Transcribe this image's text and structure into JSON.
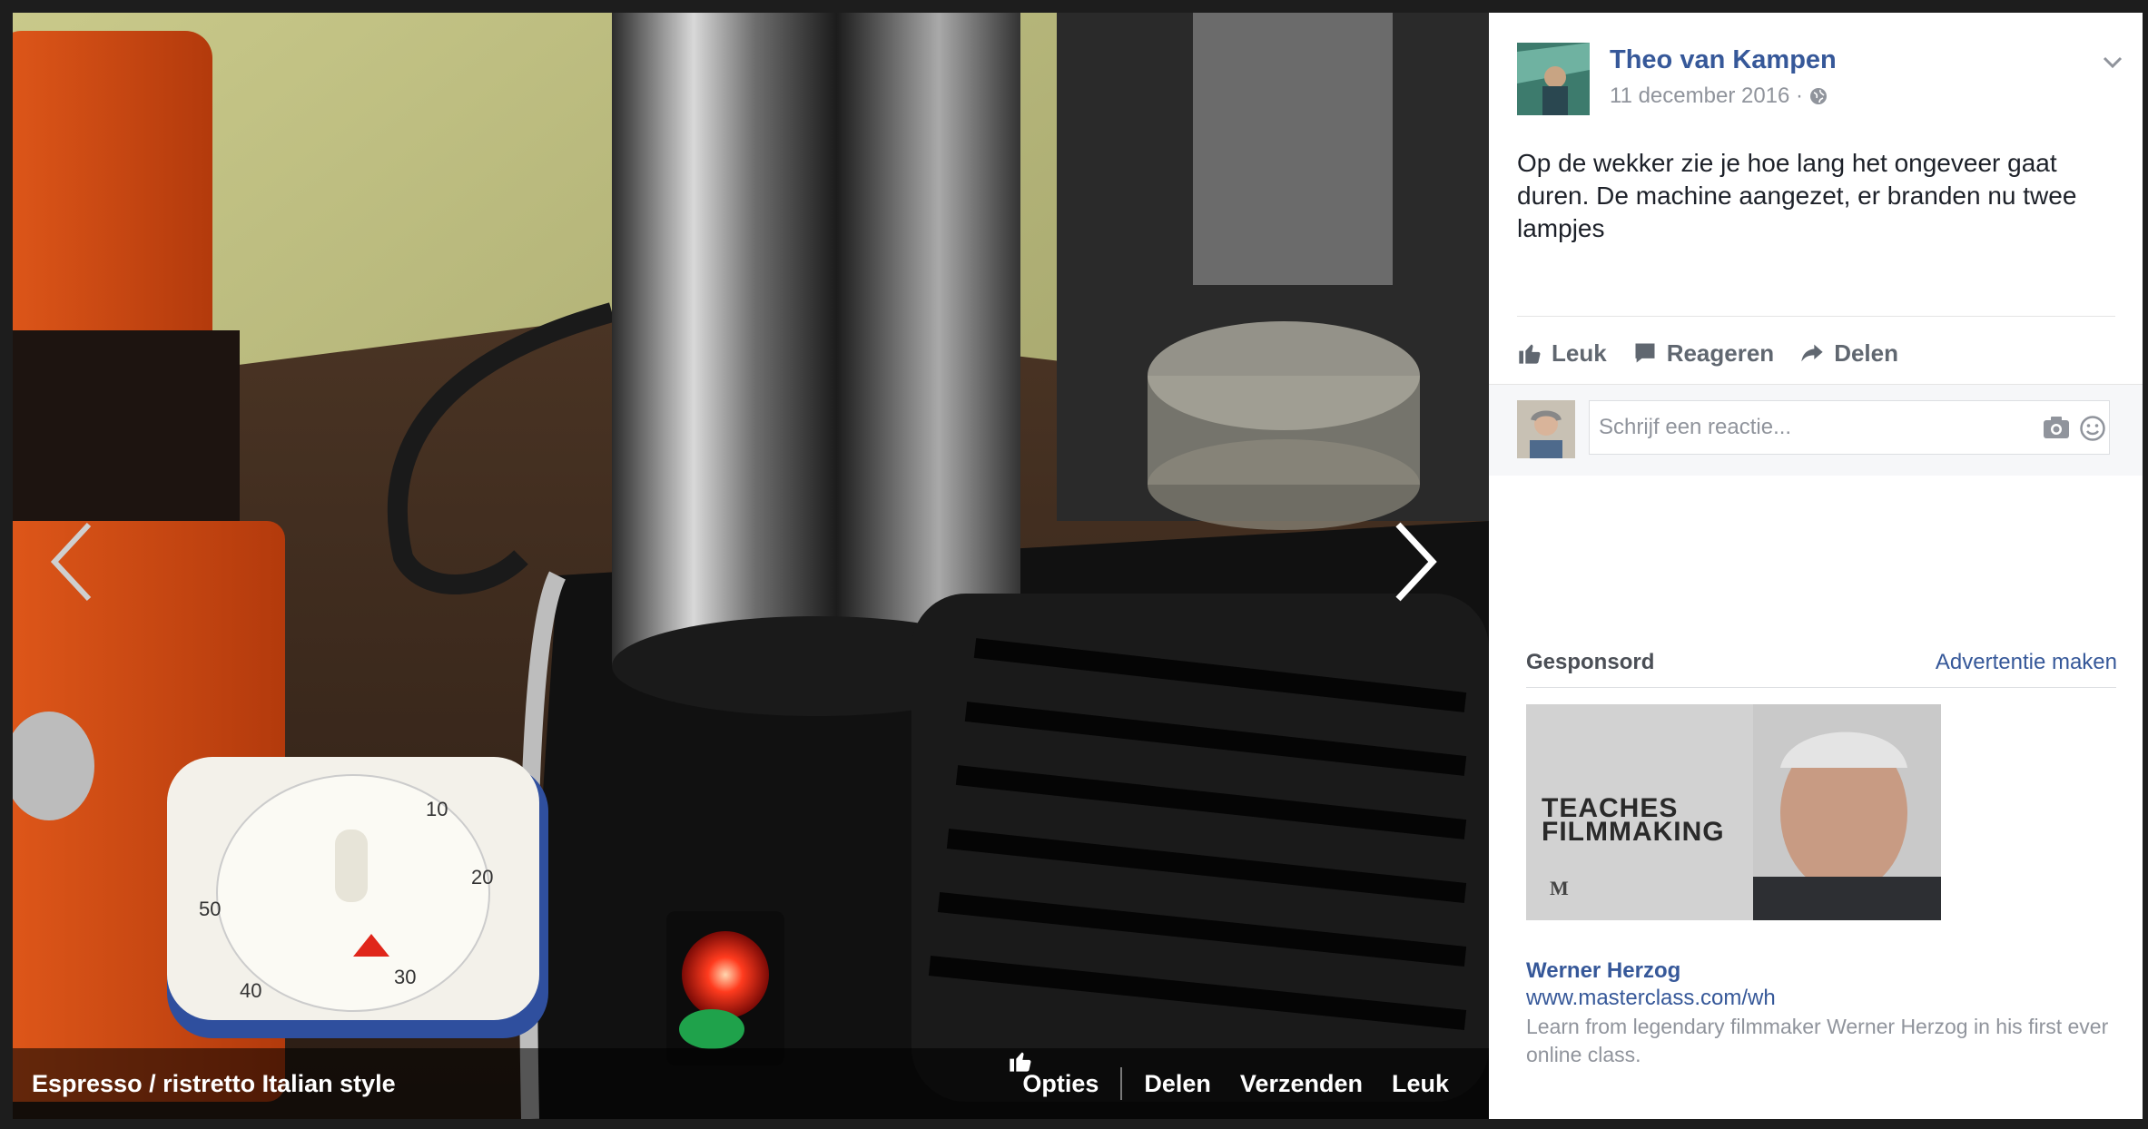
{
  "photo": {
    "caption": "Espresso / ristretto Italian style",
    "actions": {
      "options": "Opties",
      "share": "Delen",
      "send": "Verzenden",
      "like": "Leuk"
    },
    "timer_marks": [
      "10",
      "20",
      "30",
      "40",
      "50"
    ]
  },
  "post": {
    "author": "Theo van Kampen",
    "date": "11 december 2016 ·",
    "text": "Op de wekker zie je hoe lang het ongeveer gaat duren. De machine aangezet, er branden nu twee lampjes",
    "actions": {
      "like": "Leuk",
      "comment": "Reageren",
      "share": "Delen"
    },
    "comment_placeholder": "Schrijf een reactie..."
  },
  "sponsored": {
    "heading": "Gesponsord",
    "create_ad": "Advertentie maken",
    "ad": {
      "image_text_line1": "TEACHES",
      "image_text_line2": "FILMMAKING",
      "logo": "M",
      "name": "Werner Herzog",
      "url": "www.masterclass.com/wh",
      "description": "Learn from legendary filmmaker Werner Herzog in his first ever online class."
    }
  },
  "colors": {
    "link": "#365899",
    "muted": "#90949c",
    "action": "#606770"
  }
}
